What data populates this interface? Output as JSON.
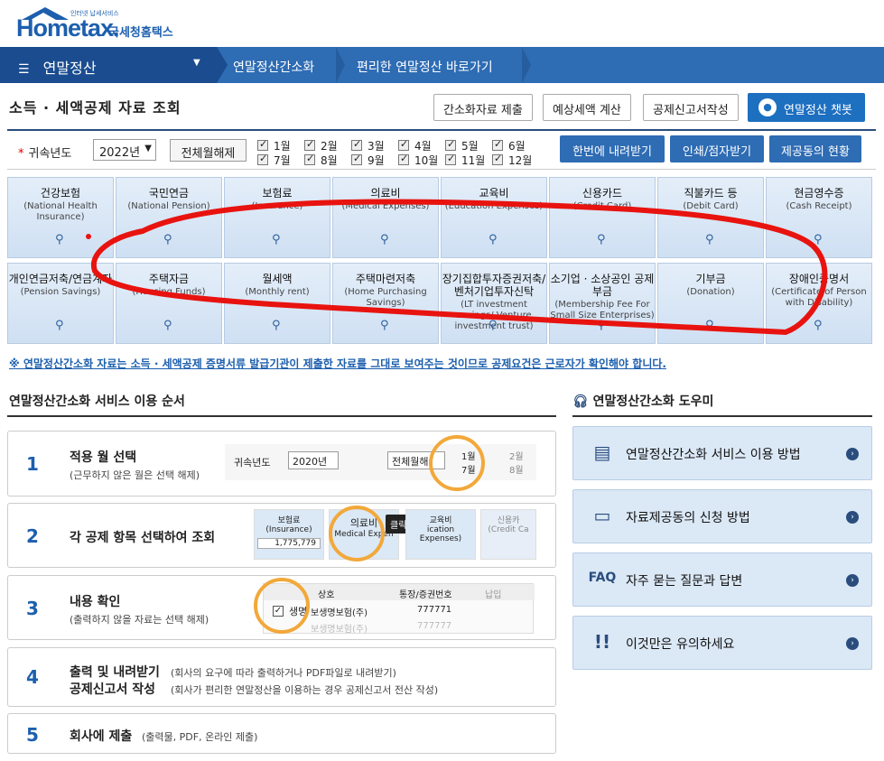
{
  "header": {
    "logo_small": "인터넷 납세서비스",
    "logo_main": "Hometax.",
    "logo_sub": "국세청홈택스"
  },
  "nav": {
    "main": "연말정산",
    "links": [
      "연말정산간소화",
      "편리한 연말정산 바로가기"
    ]
  },
  "page": {
    "title": "소득 · 세액공제 자료 조회",
    "buttons": [
      "간소화자료 제출",
      "예상세액 계산",
      "공제신고서작성"
    ],
    "chatbot": "연말정산 챗봇"
  },
  "filter": {
    "year_label": "귀속년도",
    "year_value": "2022년",
    "clear_all": "전체월해제",
    "months": [
      "1월",
      "2월",
      "3월",
      "4월",
      "5월",
      "6월",
      "7월",
      "8월",
      "9월",
      "10월",
      "11월",
      "12월"
    ],
    "actions": [
      "한번에 내려받기",
      "인쇄/점자받기",
      "제공동의 현황"
    ]
  },
  "tiles": [
    {
      "ko": "건강보험",
      "en": "(National Health Insurance)"
    },
    {
      "ko": "국민연금",
      "en": "(National Pension)"
    },
    {
      "ko": "보험료",
      "en": "(Insurance)"
    },
    {
      "ko": "의료비",
      "en": "(Medical Expenses)"
    },
    {
      "ko": "교육비",
      "en": "(Education Expenses)"
    },
    {
      "ko": "신용카드",
      "en": "(Credit Card)"
    },
    {
      "ko": "직불카드 등",
      "en": "(Debit Card)"
    },
    {
      "ko": "현금영수증",
      "en": "(Cash Receipt)"
    },
    {
      "ko": "개인연금저축/연금계좌",
      "en": "(Pension Savings)"
    },
    {
      "ko": "주택자금",
      "en": "(Housing Funds)"
    },
    {
      "ko": "월세액",
      "en": "(Monthly rent)"
    },
    {
      "ko": "주택마련저축",
      "en": "(Home Purchasing Savings)"
    },
    {
      "ko": "장기집합투자증권저축/벤처기업투자신탁",
      "en": "(LT investment savings/ Venture investment trust)"
    },
    {
      "ko": "소기업 · 소상공인 공제부금",
      "en": "(Membership Fee For Small Size Enterprises)"
    },
    {
      "ko": "기부금",
      "en": "(Donation)"
    },
    {
      "ko": "장애인증명서",
      "en": "(Certificate of Person with Disability)"
    }
  ],
  "notice": "※ 연말정산간소화 자료는 소득 · 세액공제 증명서류 발급기관이 제출한 자료를 그대로 보여주는 것이므로 공제요건은 근로자가 확인해야 합니다.",
  "steps": {
    "title": "연말정산간소화 서비스 이용 순서",
    "items": [
      {
        "num": "1",
        "title": "적용 월 선택",
        "desc": "(근무하지 않은 월은 선택 해제)"
      },
      {
        "num": "2",
        "title": "각 공제 항목 선택하여 조회",
        "desc": ""
      },
      {
        "num": "3",
        "title": "내용 확인",
        "desc": "(출력하지 않을 자료는 선택 해제)"
      },
      {
        "num": "4",
        "title": "출력 및 내려받기",
        "desc": "(회사의 요구에 따라 출력하거나 PDF파일로 내려받기)",
        "title2": "공제신고서 작성",
        "desc2": "(회사가 편리한 연말정산을 이용하는 경우 공제신고서 전산 작성)"
      },
      {
        "num": "5",
        "title": "회사에 제출",
        "desc": "(출력물, PDF, 온라인 제출)"
      }
    ],
    "illus1": {
      "year_label": "귀속년도",
      "year_value": "2020년",
      "clear": "전체월해",
      "m1": "1월",
      "m2": "2월",
      "m7": "7월",
      "m8": "8월"
    },
    "illus2": {
      "tile1_ko": "보험료",
      "tile1_en": "(Insurance)",
      "tile1_val": "1,775,779",
      "tile2_ko": "의료비",
      "tile2_en": "Medical Expen",
      "click": "클릭!",
      "tile3_ko": "교육비",
      "tile3_en": "ication Expenses)",
      "tile4_ko": "신용카",
      "tile4_en": "(Credit Ca"
    },
    "illus3": {
      "col1": "상호",
      "col2": "통장/증권번호",
      "col3": "납입",
      "row_name": "생명",
      "row_company": "보생명보험(주)",
      "row_no": "777771",
      "row2_company": "보생명보험(주)",
      "row2_no": "777777"
    }
  },
  "helper": {
    "title": "연말정산간소화 도우미",
    "items": [
      {
        "icon": "document-edit-icon",
        "label": "연말정산간소화 서비스 이용 방법"
      },
      {
        "icon": "form-icon",
        "label": "자료제공동의 신청 방법"
      },
      {
        "icon": "faq-icon",
        "label": "자주 묻는 질문과 답변",
        "prefix": "FAQ"
      },
      {
        "icon": "exclamation-icon",
        "label": "이것만은 유의하세요"
      }
    ]
  },
  "colors": {
    "nav": "#2e6cb4",
    "nav_dark": "#1a4c8f",
    "tile": "#d8e6f5",
    "annotation": "#e8130f"
  }
}
